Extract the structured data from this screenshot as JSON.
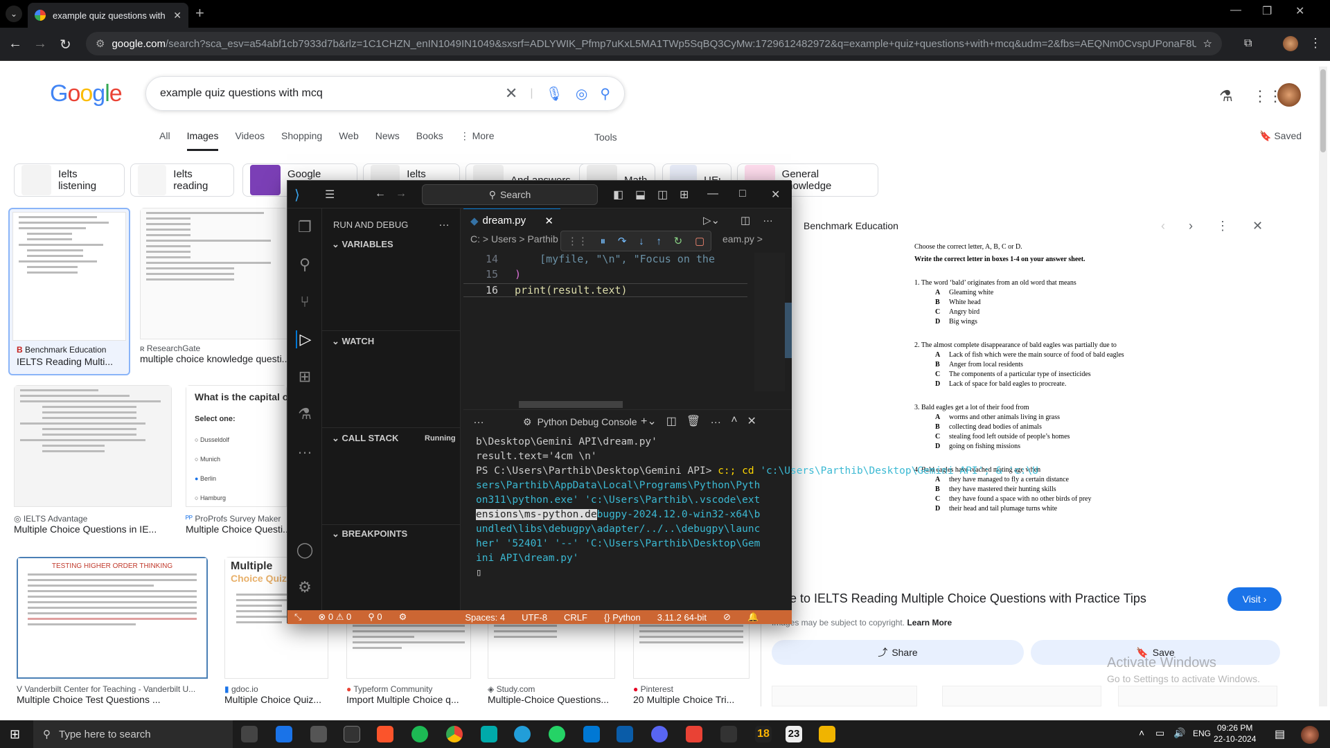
{
  "browser": {
    "tab_title": "example quiz questions with m",
    "url_domain": "google.com",
    "url_rest": "/search?sca_esv=a54abf1cb7933d7b&rlz=1C1CHZN_enIN1049IN1049&sxsrf=ADLYWIK_Pfmp7uKxL5MA1TWp5SqBQ3CyMw:1729612482972&q=example+quiz+questions+with+mcq&udm=2&fbs=AEQNm0CvspUPonaF8UH5s_LBD3JPX4RSeM..."
  },
  "google": {
    "query": "example quiz questions with mcq",
    "tabs": [
      "All",
      "Images",
      "Videos",
      "Shopping",
      "Web",
      "News",
      "Books",
      "More"
    ],
    "active_tab": "Images",
    "tools": "Tools",
    "saved": "Saved",
    "chips": [
      "Ielts listening",
      "Ielts reading",
      "Google forms",
      "Ielts exam",
      "And answers",
      "Math",
      "ЦЕь",
      "General knowledge"
    ],
    "results": [
      {
        "source": "Benchmark Education",
        "title": "IELTS Reading Multi..."
      },
      {
        "source": "ResearchGate",
        "title": "multiple choice knowledge questi..."
      },
      {
        "source": "IELTS Advantage",
        "title": "Multiple Choice Questions in IE..."
      },
      {
        "source": "ProProfs Survey Maker",
        "title": "Multiple Choice Questi..."
      },
      {
        "source": "Vanderbilt Center for Teaching - Vanderbilt U...",
        "title": "Multiple Choice Test Questions ..."
      },
      {
        "source": "gdoc.io",
        "title": "Multiple Choice Quiz..."
      },
      {
        "source": "Typeform Community",
        "title": "Import Multiple Choice q..."
      },
      {
        "source": "Study.com",
        "title": "Multiple-Choice Questions..."
      },
      {
        "source": "Pinterest",
        "title": "20 Multiple Choice Tri..."
      }
    ],
    "thumb_texts": {
      "capital": "What is the capital of...",
      "select_one": "Select one:",
      "opts": [
        "Dusseldolf",
        "Munich",
        "Berlin",
        "Hamburg"
      ],
      "hot": "TESTING HIGHER ORDER THINKING",
      "mc": "Multiple",
      "mc2": "Choice Quiz"
    }
  },
  "panel": {
    "source": "Benchmark Education",
    "caption": "de to IELTS Reading Multiple Choice Questions with Practice Tips",
    "visit": "Visit",
    "copyright": "Images may be subject to copyright.",
    "learn_more": "Learn More",
    "share": "Share",
    "save": "Save",
    "doc": {
      "h1": "Choose the correct letter, A, B, C or D.",
      "h2": "Write the correct letter in boxes 1-4 on your answer sheet.",
      "q1": "1.  The word ‘bald’ originates from an old word that means",
      "q1o": [
        "Gleaming white",
        "White head",
        "Angry bird",
        "Big wings"
      ],
      "q2": "2.  The almost complete disappearance of bald eagles was partially due to",
      "q2o": [
        "Lack of fish which were the main source of food of bald eagles",
        "Anger from local residents",
        "The components of a particular type of insecticides",
        "Lack of space for bald eagles to procreate."
      ],
      "q3": "3.  Bald eagles get a lot of their food from",
      "q3o": [
        "worms and other animals living in grass",
        "collecting dead bodies of animals",
        "stealing food left outside of people’s homes",
        "going on fishing missions"
      ],
      "q4": "4.  Bald eagles have reached mating age when",
      "q4o": [
        "they have managed to fly a certain distance",
        "they have mastered their hunting skills",
        "they have found a space with no other birds of prey",
        "their head and tail plumage turns white"
      ],
      "letters": [
        "A",
        "B",
        "C",
        "D"
      ]
    }
  },
  "activate": {
    "l1": "Activate Windows",
    "l2": "Go to Settings to activate Windows."
  },
  "vscode": {
    "search": "Search",
    "run_debug": "RUN AND DEBUG",
    "variables": "VARIABLES",
    "watch": "WATCH",
    "call_stack": "CALL STACK",
    "running": "Running",
    "breakpoints": "BREAKPOINTS",
    "file_tab": "dream.py",
    "breadcrumb": "C: > Users > Parthib",
    "crumb_end": "eam.py >",
    "code": [
      {
        "n": "14",
        "t": "    [myfile, \"\\n\", \"Focus on the"
      },
      {
        "n": "15",
        "t": ")"
      },
      {
        "n": "16",
        "t": "print(result.text)"
      }
    ],
    "console_title": "Python Debug Console",
    "terminal": [
      "b\\Desktop\\Gemini API\\dream.py'",
      "result.text='4cm \\n'"
    ],
    "prompt": "PS C:\\Users\\Parthib\\Desktop\\Gemini API> ",
    "cmd1": "c:; cd",
    "cmd2": " 'c:\\Users\\Parthib\\Desktop\\Gemini API'; & 'c:\\U\nsers\\Parthib\\AppData\\Local\\Programs\\Python\\Pyth\non311\\python.exe' 'c:\\Users\\Parthib\\.vscode\\ext\n",
    "cmd_sel": "ensions\\ms-python.de",
    "cmd3": "bugpy-2024.12.0-win32-x64\\b\nundled\\libs\\debugpy\\adapter/../..\\debugpy\\launc\nher' '52401' '--' 'C:\\Users\\Parthib\\Desktop\\Gem\nini API\\dream.py'",
    "status": {
      "errors": "0",
      "warnings": "0",
      "ports": "0",
      "spaces": "Spaces: 4",
      "encoding": "UTF-8",
      "eol": "CRLF",
      "lang": "Python",
      "version": "3.11.2 64-bit"
    }
  },
  "taskbar": {
    "search": "Type here to search",
    "lang": "ENG",
    "time": "09:26 PM",
    "date": "22-10-2024",
    "badge1": "18",
    "badge2": "23"
  }
}
